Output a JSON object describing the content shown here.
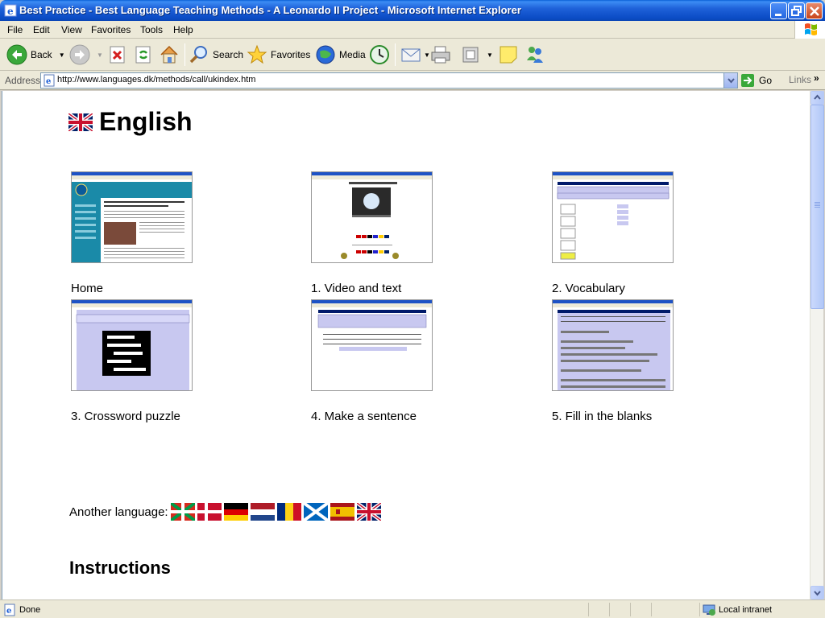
{
  "window": {
    "title": "Best Practice - Best Language Teaching Methods - A Leonardo II Project - Microsoft Internet Explorer"
  },
  "menu": [
    "File",
    "Edit",
    "View",
    "Favorites",
    "Tools",
    "Help"
  ],
  "toolbar": {
    "back": "Back",
    "search": "Search",
    "favorites": "Favorites",
    "media": "Media"
  },
  "address": {
    "label": "Address",
    "url": "http://www.languages.dk/methods/call/ukindex.htm",
    "go": "Go",
    "links": "Links"
  },
  "page": {
    "heading": "English",
    "items": [
      {
        "caption": "Home"
      },
      {
        "caption": "1. Video and text"
      },
      {
        "caption": "2. Vocabulary"
      },
      {
        "caption": "3. Crossword puzzle"
      },
      {
        "caption": "4. Make a sentence"
      },
      {
        "caption": "5. Fill in the blanks"
      }
    ],
    "another_language": "Another language:",
    "flags": [
      "basque-flag",
      "danish-flag",
      "german-flag",
      "dutch-flag",
      "romanian-flag",
      "scottish-flag",
      "spanish-flag",
      "uk-flag"
    ],
    "instructions": "Instructions"
  },
  "status": {
    "text": "Done",
    "zone": "Local intranet"
  }
}
